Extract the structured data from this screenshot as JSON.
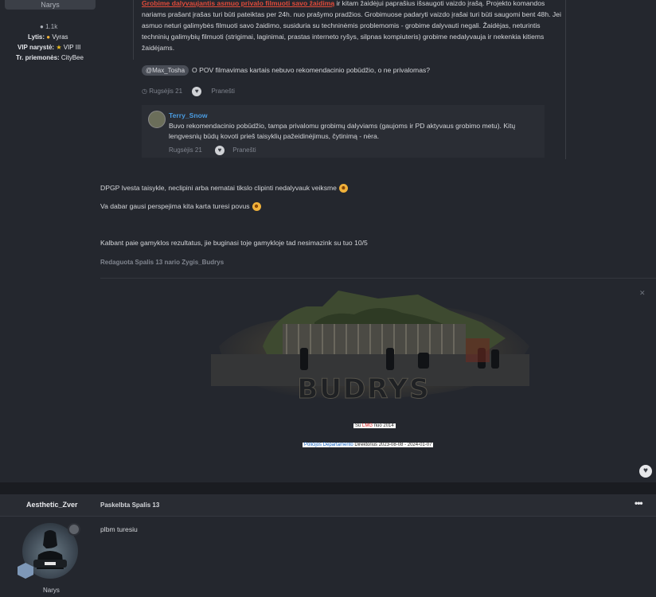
{
  "sidebar": {
    "rank": "Narys",
    "post_count": "1.1k",
    "gender_label": "Lytis:",
    "gender_value": "Vyras",
    "vip_label": "VIP narystė:",
    "vip_value": "VIP III",
    "tr_label": "Tr. priemonės:",
    "tr_value": "CityBee"
  },
  "quote": {
    "red_text": "Grobime dalyvaujantis asmuo privalo filmuoti savo žaidimą",
    "body": " ir kitam žaidėjui paprašius išsaugoti vaizdo įrašą. Projekto komandos nariams prašant įrašas turi būti pateiktas per 24h. nuo prašymo pradžios. Grobimuose padaryti vaizdo įrašai turi būti saugomi bent 48h. Jei asmuo neturi galimybės filmuoti savo  žaidimo, susiduria su techninėmis problemomis  - grobime dalyvauti negali. Žaidėjas, neturintis techninių galimybių  filmuoti (strigimai, laginimai, prastas interneto ryšys, silpnas kompiuteris) grobime nedalyvauja ir nekenkia kitiems žaidėjams.",
    "mention": "@Max_Tosha",
    "question": "O POV filmavimas kartais nebuvo rekomendacinio pobūdžio, o ne privalomas?",
    "date": "Rugsėjis 21",
    "report": "Pranešti"
  },
  "reply": {
    "author": "Terry_Snow",
    "text": "Buvo rekomendacinio pobūdžio, tampa privalomu grobimų dalyviams (gaujoms ir PD aktyvaus grobimo metu). Kitų lengvesnių būdų kovoti prieš taisyklių pažeidinėjimus, čytinimą - nėra.",
    "date": "Rugsėjis 21",
    "report": "Pranešti"
  },
  "post": {
    "line1": "DPGP Ivesta taisykle, neclipini arba nematai tikslo clipinti nedalyvauk veiksme",
    "line2": "Va dabar gausi perspejima kita karta turesi povus",
    "line3": "Kalbant paie gamyklos rezultatus, jie buginasi toje gamykloje tad nesimazink su tuo 10/5",
    "edited": "Redaguota Spalis 13 nario Zygis_Budrys"
  },
  "signature": {
    "banner_text": "BUDRYS",
    "since_prefix": "Su ",
    "since_brand": "LMG",
    "since_suffix": " nuo 2014",
    "dept_name": "Policijos Departamento",
    "dept_rest": " Direktorius 2023-08-08 - 2024-01-07"
  },
  "next_post": {
    "author": "Aesthetic_Zver",
    "posted": "Paskelbta Spalis 13",
    "message": "plbm turesiu",
    "rank": "Narys",
    "menu_glyph": "•••"
  },
  "icons": {
    "comment": "comment-icon",
    "heart": "heart-icon",
    "clock": "clock-icon",
    "emoji": "grinning-emoji-icon"
  },
  "colors": {
    "background": "#24272e",
    "accent_red": "#e04b3a",
    "link_blue": "#4a9be0"
  }
}
